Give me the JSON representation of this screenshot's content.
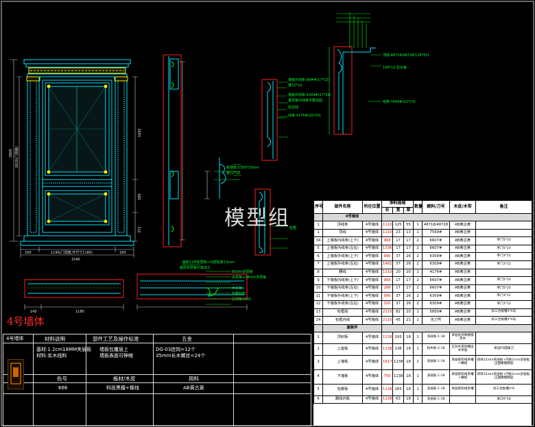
{
  "watermark": "模型组",
  "wall_title": "4号墙体",
  "colors": {
    "background": "#000000",
    "cyan": "#00ffff",
    "green": "#00ff00",
    "red": "#ff2020",
    "yellow": "#ffee00",
    "table_bg": "#ffffff"
  },
  "elevation_dims": {
    "widths": [
      "160",
      "1190(门洞宽,开尺寸1180)",
      "160"
    ],
    "total_width": "1540",
    "left_vertical": [
      "2800",
      "2620(门洞高)"
    ],
    "right_vertical": [
      "1602",
      "580",
      "372"
    ]
  },
  "section_notes": [
    "顶线:48718/48728(135*55)",
    "100*12 拉木板",
    "墙板外线条:68##(17*15)",
    "宽12*10",
    "墙板外线条:4309#(27*26)",
    "基层板内线条平整加固",
    "包边线",
    "线条:7669#(22*13)",
    "线条:4176#(20*20)",
    "新墙体:5350*15mm",
    "宽12*10",
    "包框",
    "面积12M多层板+内部包板13mm",
    "基层多层板打底加工",
    "600ml多层板",
    "多层板+18mm多层板",
    "木工板",
    "包覆材料",
    "压线条2300"
  ],
  "plan_dims": [
    "140",
    "1180"
  ],
  "parts_table": {
    "headers": [
      "序号",
      "部件名称",
      "所在位置",
      "净料规格",
      "数量",
      "颜料/刀号",
      "木皮/木带",
      "备注"
    ],
    "subheaders": [
      "长",
      "宽",
      "厚"
    ],
    "section_label": "4号墙体",
    "rows": [
      [
        "1",
        "顶线条",
        "4号墙体",
        "1110",
        "125",
        "55",
        "1",
        "48718/48728",
        "AB黄古黄",
        ""
      ],
      [
        "1",
        "顶线",
        "4号墙体",
        "1110",
        "23",
        "13",
        "1",
        "7569#",
        "AB黄古黄",
        ""
      ],
      [
        "34",
        "上墙板内线条(上下)",
        "4号墙体",
        "968",
        "17",
        "17",
        "2",
        "6607#",
        "AB黄古黄",
        "吊门5*10"
      ],
      [
        "5",
        "上墙板内线条(左右)",
        "4号墙体",
        "1336",
        "17",
        "17",
        "2",
        "6607#",
        "AB黄古黄",
        "吊门5*10"
      ],
      [
        "6",
        "上墙板外线条(上下)",
        "4号墙体",
        "990",
        "37",
        "26",
        "2",
        "6309#",
        "AB黄古黄",
        "吊门3*12"
      ],
      [
        "7",
        "上墙板外线条(左右)",
        "4号墙体",
        "1482",
        "37",
        "26",
        "2",
        "6309#",
        "AB黄古黄",
        "吊门3*12"
      ],
      [
        "8",
        "腰线",
        "4号墙体",
        "1110",
        "20",
        "20",
        "1",
        "4176#",
        "AB黄古黄",
        ""
      ],
      [
        "9",
        "下墙板内线条(上下)",
        "4号墙体",
        "968",
        "17",
        "17",
        "2",
        "6607#",
        "AB黄古黄",
        "吊门5*10"
      ],
      [
        "10",
        "下墙板内线条(左右)",
        "4号墙体",
        "288",
        "17",
        "17",
        "2",
        "6607#",
        "AB黄古黄",
        "吊门5*10"
      ],
      [
        "11",
        "下墙板外线条(上下)",
        "4号墙体",
        "990",
        "37",
        "26",
        "2",
        "6309#",
        "AB黄古黄",
        "吊门3*12"
      ],
      [
        "12",
        "下墙板外线条(左右)",
        "4号墙体",
        "320",
        "37",
        "26",
        "2",
        "6309#",
        "AB黄古黄",
        "吊门3*12"
      ],
      [
        "13",
        "包框线",
        "4号墙体",
        "2110",
        "82",
        "20",
        "1",
        "5800#",
        "AB黄古黄",
        "扣三合板槽3*6号"
      ],
      [
        "14",
        "包框内线",
        "4号墙体",
        "2110",
        "45",
        "21",
        "1",
        "无刀号",
        "AB黄古黄",
        "扣三合板槽3*6号"
      ]
    ],
    "panel_label": "面板件",
    "panel_rows": [
      [
        "1",
        "顶封板",
        "4号墙体",
        "1138",
        "193",
        "18",
        "1",
        "多层板-1-18",
        "单层胶夹制模锁夹木",
        "",
        ""
      ],
      [
        "2",
        "上座板",
        "4号墙体",
        "1138",
        "138",
        "18",
        "1",
        "松木板-2-18",
        "正封木夹封横边木夹层",
        "单边R5圆角刀",
        ""
      ],
      [
        "3",
        "上墙板",
        "4号墙体",
        "1617",
        "1138",
        "18",
        "1",
        "多层板-1-18",
        "单层胶料线夹槽+横线",
        "四块12mm夹层板+内板1mm多层板,正面硬圈圈层",
        "",
        ""
      ],
      [
        "4",
        "下墙板",
        "4号墙体",
        "750",
        "1138",
        "18",
        "1",
        "多层板-1-18",
        "单层胶料线夹槽+横线",
        "四块12mm夹层板+内板1mm多层板,正面硬圈圈层",
        "",
        ""
      ],
      [
        "5",
        "包脚板",
        "4号墙体",
        "1138",
        "183",
        "18",
        "1",
        "多层板-1-18",
        "单层胶料线夹槽",
        "扣三合板槽3*6",
        ""
      ],
      [
        "6",
        "踢线内板",
        "4号墙体",
        "1138",
        "63",
        "18",
        "1",
        "多层板-1-18",
        "",
        "宽口6*18",
        ""
      ]
    ]
  },
  "legend": {
    "label": "4号墙体",
    "material_header": "材料说明",
    "material_text": "基材:1.2cm18MM夹层板\n材料:实木线料",
    "process_header": "部件工艺及操作标准",
    "process_text": "墙板包覆层上\n墙板表面可伸缩",
    "hardware_header": "五金",
    "hardware_text": "DG-03挂钩=12个\n35mm长木螺丝=24个",
    "color_header": "色号",
    "color_value": "666",
    "wood_header": "板材/木皮",
    "wood_value": "科技黑檀+橡线",
    "finish_header": "用料",
    "finish_value": "AB黄古黄"
  }
}
